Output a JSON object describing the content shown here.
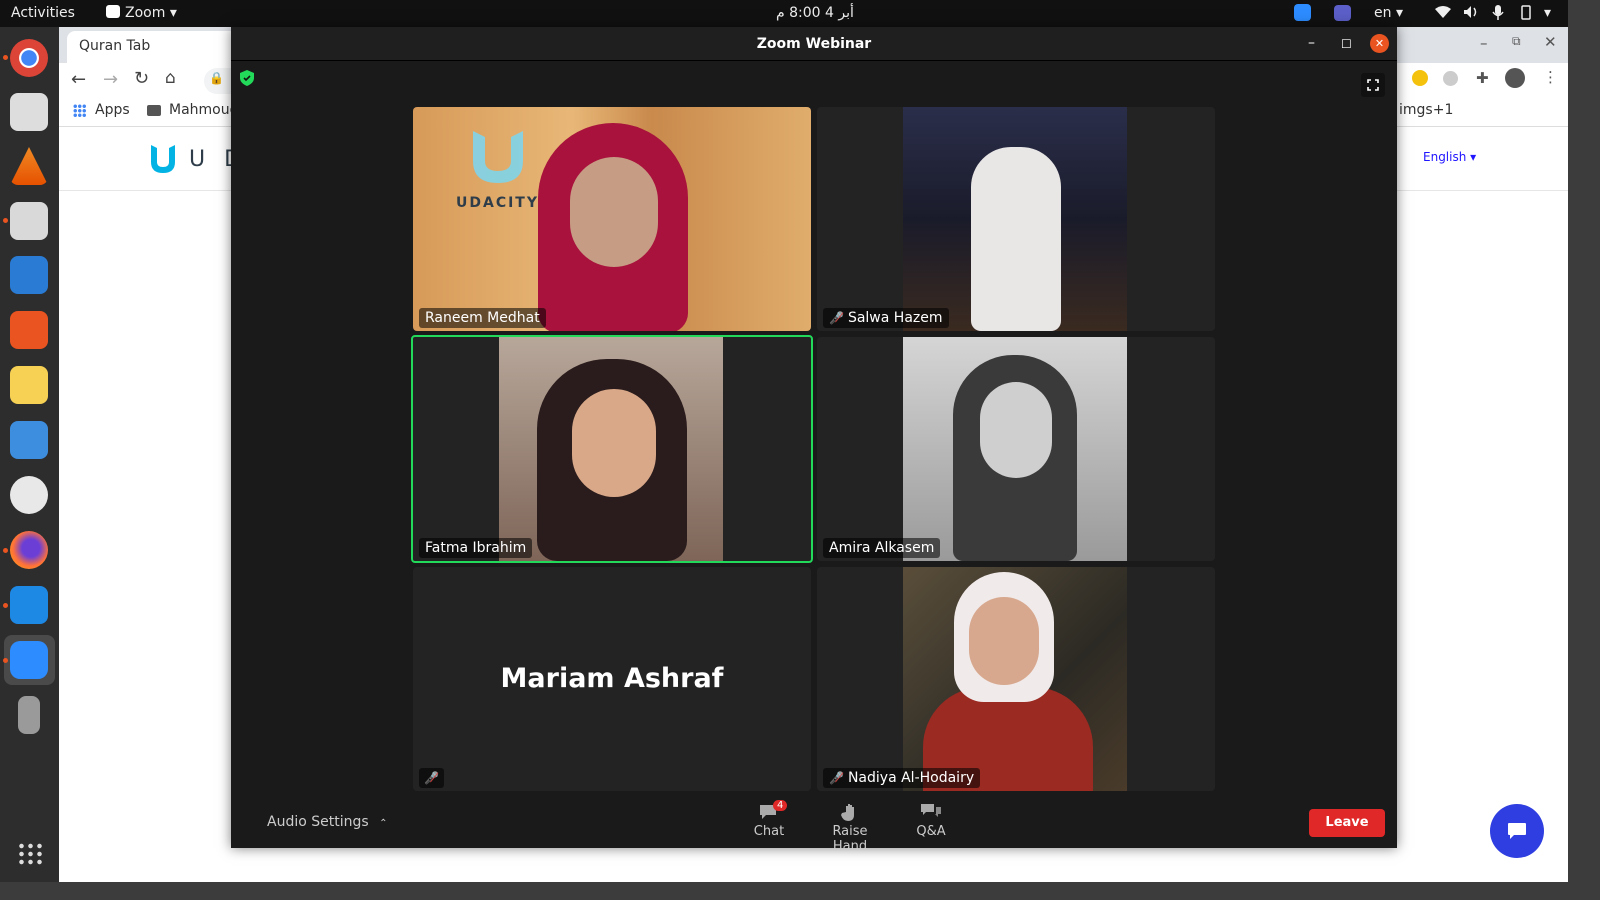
{
  "topbar": {
    "activities": "Activities",
    "app_menu": "Zoom",
    "clock": "أبر 4  8:00 م",
    "lang": "en"
  },
  "browser": {
    "tab_title": "Quran Tab",
    "bookmarks": {
      "apps": "Apps",
      "folder": "Mahmoud",
      "right_item": "imgs+1"
    },
    "udacity_logo_text": "U D",
    "language_select": "English"
  },
  "zoom": {
    "window_title": "Zoom Webinar",
    "participants": [
      {
        "name": "Raneem Medhat",
        "muted": false,
        "video": true
      },
      {
        "name": "Salwa Hazem",
        "muted": true,
        "video": true
      },
      {
        "name": "Fatma Ibrahim",
        "muted": false,
        "video": true,
        "active": true
      },
      {
        "name": "Amira Alkasem",
        "muted": false,
        "video": true
      },
      {
        "name": "Mariam Ashraf",
        "muted": true,
        "video": false
      },
      {
        "name": "Nadiya Al-Hodairy",
        "muted": true,
        "video": true
      }
    ],
    "tile_brand_text": "UDACITY",
    "toolbar": {
      "audio_settings": "Audio Settings",
      "chat": "Chat",
      "chat_badge": "4",
      "raise_hand": "Raise Hand",
      "qa": "Q&A",
      "leave": "Leave"
    }
  },
  "colors": {
    "active_speaker_border": "#23d959",
    "leave_button": "#e02828",
    "zoom_bg": "#1a1a1a"
  }
}
